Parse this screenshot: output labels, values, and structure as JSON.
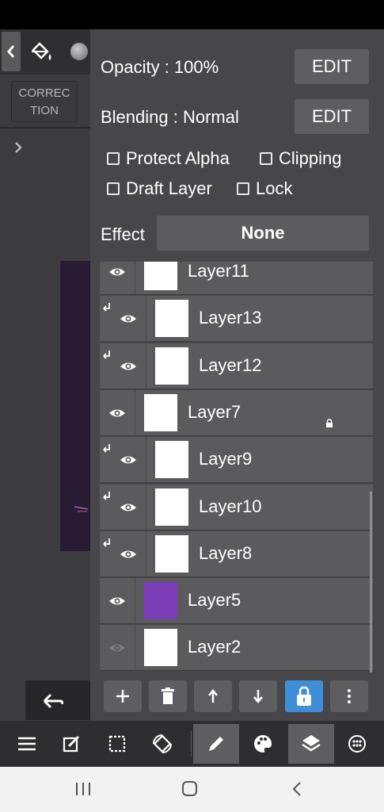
{
  "left": {
    "correction_label_1": "CORREC",
    "correction_label_2": "TION"
  },
  "panel": {
    "opacity_label": "Opacity : 100%",
    "opacity_edit": "EDIT",
    "blending_label": "Blending : Normal",
    "blending_edit": "EDIT",
    "protect_alpha": "Protect Alpha",
    "clipping": "Clipping",
    "draft_layer": "Draft Layer",
    "lock": "Lock",
    "effect_label": "Effect",
    "effect_value": "None"
  },
  "layers": [
    {
      "name": "Layer11",
      "clipped": false,
      "visible": true
    },
    {
      "name": "Layer13",
      "clipped": true,
      "visible": true
    },
    {
      "name": "Layer12",
      "clipped": true,
      "visible": true
    },
    {
      "name": "Layer7",
      "clipped": false,
      "visible": true,
      "locked": true
    },
    {
      "name": "Layer9",
      "clipped": true,
      "visible": true
    },
    {
      "name": "Layer10",
      "clipped": true,
      "visible": true
    },
    {
      "name": "Layer8",
      "clipped": true,
      "visible": true
    },
    {
      "name": "Layer5",
      "clipped": false,
      "visible": true,
      "color": "#7b3db8"
    },
    {
      "name": "Layer2",
      "clipped": false,
      "visible": false
    }
  ],
  "layer_tools": [
    "add-icon",
    "trash-icon",
    "arrow-up-icon",
    "arrow-down-icon",
    "lock-icon",
    "more-vertical-icon"
  ],
  "bottom_nav": [
    "menu-icon",
    "edit-icon",
    "selection-icon",
    "transform-icon",
    "brush-icon",
    "palette-icon",
    "layers-icon",
    "materials-icon"
  ],
  "colors": {
    "accent_blue": "#3e8ed8",
    "panel_bg": "#474749"
  }
}
